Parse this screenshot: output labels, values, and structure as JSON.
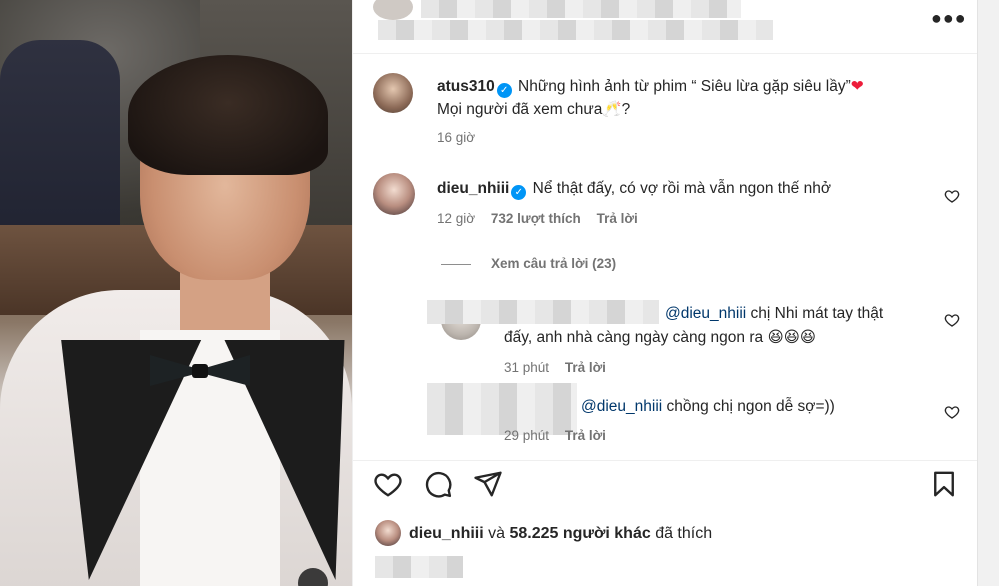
{
  "post": {
    "author": "atus310",
    "caption_line1": "Những hình ảnh từ phim “ Siêu lừa gặp siêu lầy”",
    "caption_line2": "Mọi người đã xem chưa",
    "caption_end": "?",
    "time": "16 giờ"
  },
  "comments": [
    {
      "username": "dieu_nhiii",
      "text": "Nể thật đấy, có vợ rồi mà vẫn ngon thế nhở",
      "time": "12 giờ",
      "likes": "732 lượt thích",
      "reply_label": "Trả lời",
      "view_replies": "Xem câu trả lời (23)"
    }
  ],
  "replies": [
    {
      "mention": "@dieu_nhiii",
      "text_line1": "chị Nhi mát tay thật",
      "text_line2": "đấy, anh nhà càng ngày càng ngon ra",
      "emoji": "😆😆😆",
      "time": "31 phút",
      "reply_label": "Trả lời"
    },
    {
      "mention": "@dieu_nhiii",
      "text": "chồng chị ngon dễ sợ=))",
      "time": "29 phút",
      "reply_label": "Trả lời"
    }
  ],
  "likes_summary": {
    "user": "dieu_nhiii",
    "connector": "và",
    "count": "58.225 người khác",
    "suffix": "đã thích"
  },
  "icons": {
    "heart": "heart-icon",
    "comment": "comment-icon",
    "share": "share-icon",
    "save": "bookmark-icon",
    "more": "more-icon"
  },
  "colors": {
    "verified": "#0095f6",
    "heart_red": "#ed1c3a",
    "mention": "#00376b"
  }
}
